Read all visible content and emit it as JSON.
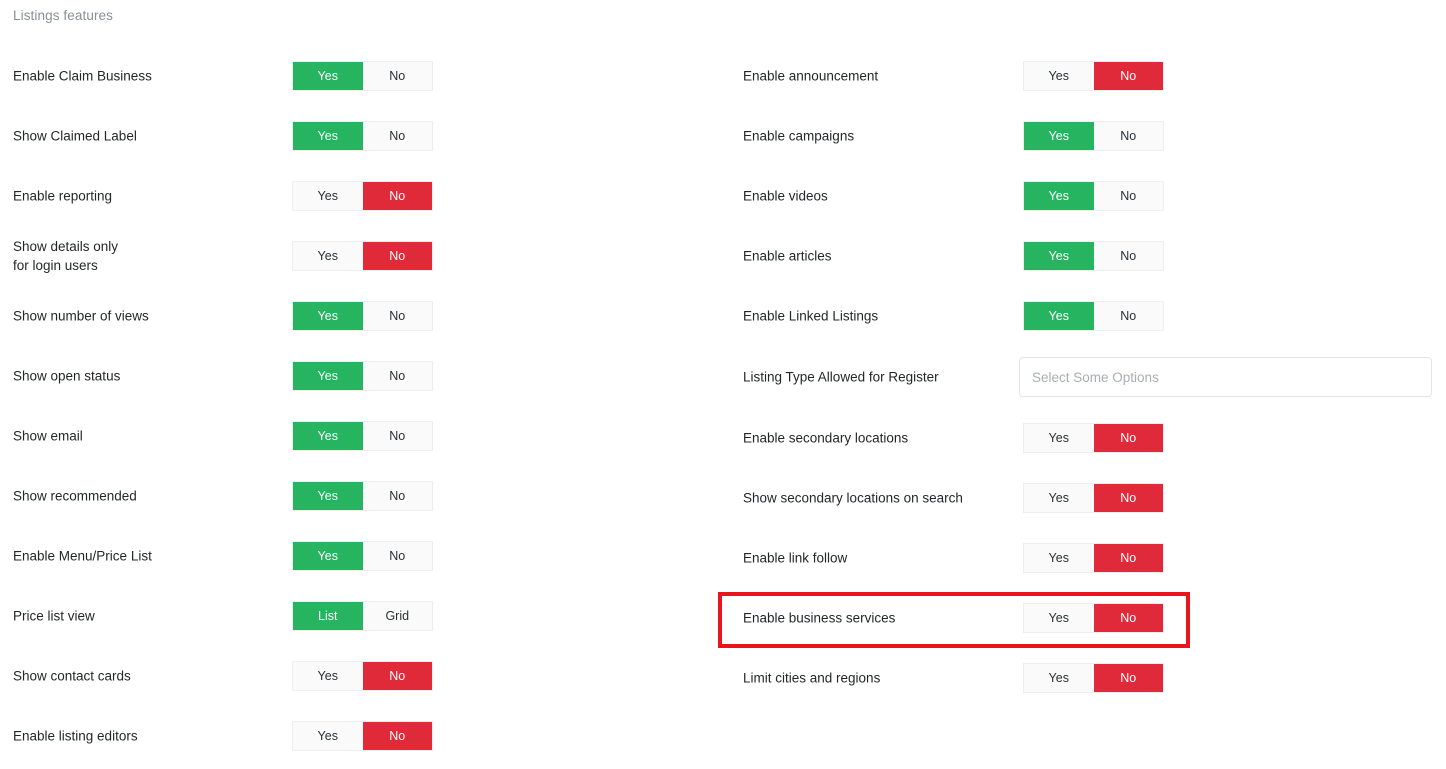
{
  "section": {
    "title": "Listings features"
  },
  "toggle_labels": {
    "yes": "Yes",
    "no": "No",
    "list": "List",
    "grid": "Grid"
  },
  "colors": {
    "green": "#27b460",
    "red": "#e02a39",
    "highlight": "#e9141c",
    "label": "#242729",
    "section_title": "#8a8f94",
    "toggle_off_bg": "#fafafa"
  },
  "left_column": [
    {
      "label": "Enable Claim Business",
      "options": [
        "Yes",
        "No"
      ],
      "selected": 0,
      "state": "green"
    },
    {
      "label": "Show Claimed Label",
      "options": [
        "Yes",
        "No"
      ],
      "selected": 0,
      "state": "green"
    },
    {
      "label": "Enable reporting",
      "options": [
        "Yes",
        "No"
      ],
      "selected": 1,
      "state": "red"
    },
    {
      "label": "Show details only\nfor login users",
      "options": [
        "Yes",
        "No"
      ],
      "selected": 1,
      "state": "red"
    },
    {
      "label": "Show number of views",
      "options": [
        "Yes",
        "No"
      ],
      "selected": 0,
      "state": "green"
    },
    {
      "label": "Show open status",
      "options": [
        "Yes",
        "No"
      ],
      "selected": 0,
      "state": "green"
    },
    {
      "label": "Show email",
      "options": [
        "Yes",
        "No"
      ],
      "selected": 0,
      "state": "green"
    },
    {
      "label": "Show recommended",
      "options": [
        "Yes",
        "No"
      ],
      "selected": 0,
      "state": "green"
    },
    {
      "label": "Enable Menu/Price List",
      "options": [
        "Yes",
        "No"
      ],
      "selected": 0,
      "state": "green"
    },
    {
      "label": "Price list view",
      "options": [
        "List",
        "Grid"
      ],
      "selected": 0,
      "state": "green"
    },
    {
      "label": "Show contact cards",
      "options": [
        "Yes",
        "No"
      ],
      "selected": 1,
      "state": "red"
    },
    {
      "label": "Enable listing editors",
      "options": [
        "Yes",
        "No"
      ],
      "selected": 1,
      "state": "red"
    }
  ],
  "right_column": [
    {
      "type": "toggle",
      "label": "Enable announcement",
      "options": [
        "Yes",
        "No"
      ],
      "selected": 1,
      "state": "red"
    },
    {
      "type": "toggle",
      "label": "Enable campaigns",
      "options": [
        "Yes",
        "No"
      ],
      "selected": 0,
      "state": "green"
    },
    {
      "type": "toggle",
      "label": "Enable videos",
      "options": [
        "Yes",
        "No"
      ],
      "selected": 0,
      "state": "green"
    },
    {
      "type": "toggle",
      "label": "Enable articles",
      "options": [
        "Yes",
        "No"
      ],
      "selected": 0,
      "state": "green"
    },
    {
      "type": "toggle",
      "label": "Enable Linked Listings",
      "options": [
        "Yes",
        "No"
      ],
      "selected": 0,
      "state": "green"
    },
    {
      "type": "select",
      "label": "Listing Type Allowed for Register",
      "value": "",
      "placeholder": "Select Some Options"
    },
    {
      "type": "toggle",
      "label": "Enable secondary locations",
      "options": [
        "Yes",
        "No"
      ],
      "selected": 1,
      "state": "red"
    },
    {
      "type": "toggle",
      "label": "Show secondary locations on search",
      "options": [
        "Yes",
        "No"
      ],
      "selected": 1,
      "state": "red"
    },
    {
      "type": "toggle",
      "label": "Enable link follow",
      "options": [
        "Yes",
        "No"
      ],
      "selected": 1,
      "state": "red"
    },
    {
      "type": "toggle",
      "label": "Enable business services",
      "options": [
        "Yes",
        "No"
      ],
      "selected": 1,
      "state": "red",
      "highlighted": true
    },
    {
      "type": "toggle",
      "label": "Limit cities and regions",
      "options": [
        "Yes",
        "No"
      ],
      "selected": 1,
      "state": "red"
    }
  ]
}
